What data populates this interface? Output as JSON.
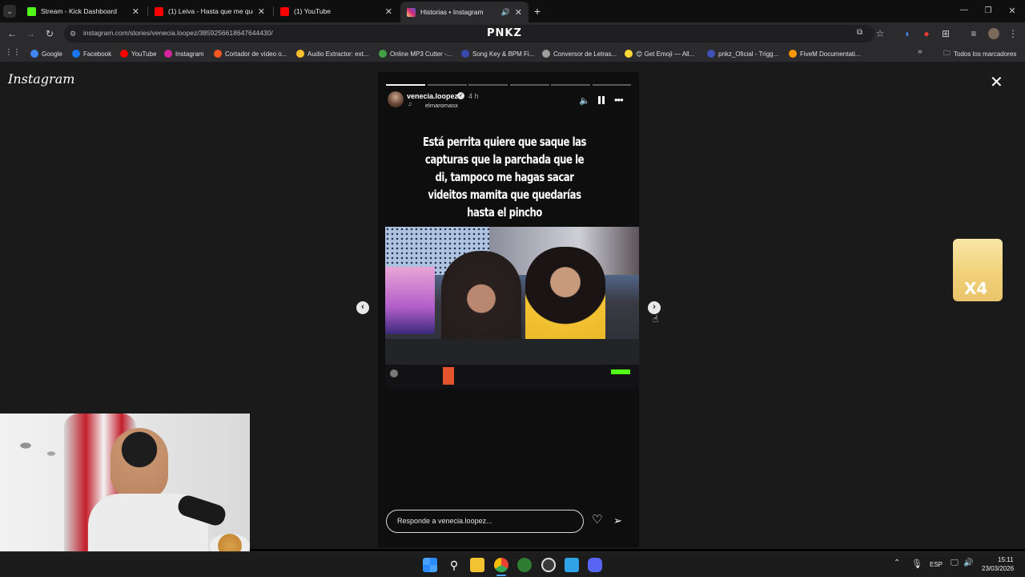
{
  "browser": {
    "tabs": [
      {
        "title": "Stream - Kick Dashboard",
        "favicon": "kick-icon",
        "color": "#53fc18"
      },
      {
        "title": "(1) Leiva - Hasta que me quede",
        "favicon": "youtube-icon",
        "color": "#ff0000"
      },
      {
        "title": "(1) YouTube",
        "favicon": "youtube-icon",
        "color": "#ff0000"
      },
      {
        "title": "Historias • Instagram",
        "favicon": "instagram-icon",
        "color": "#d6249f"
      }
    ],
    "url": "instagram.com/stories/venecia.loopez/3859256618647644430/",
    "profile_label": "PNKZ",
    "bookmarks": [
      {
        "label": "Google",
        "color": "#4285f4"
      },
      {
        "label": "Facebook",
        "color": "#1877f2"
      },
      {
        "label": "YouTube",
        "color": "#ff0000"
      },
      {
        "label": "Instagram",
        "color": "#d6249f"
      },
      {
        "label": "Cortador de vídeo o...",
        "color": "#ff5722"
      },
      {
        "label": "Audio Extractor: ext...",
        "color": "#fbc02d"
      },
      {
        "label": "Online MP3 Cutter -...",
        "color": "#43a047"
      },
      {
        "label": "Song Key & BPM Fi...",
        "color": "#3949ab"
      },
      {
        "label": "Conversor de Letras...",
        "color": "#9e9e9e"
      },
      {
        "label": "😊 Get Emoji — All...",
        "color": "#fdd835"
      },
      {
        "label": "pnkz_Oficial - Trigg...",
        "color": "#3f51b5"
      },
      {
        "label": "FiveM Documentati...",
        "color": "#ff9800"
      }
    ],
    "all_bookmarks_label": "Todos los marcadores"
  },
  "instagram": {
    "logo_text": "Instagram",
    "story": {
      "username": "venecia.loopez",
      "verified": true,
      "time_ago": "4 h",
      "audio_label": "elmaromasx",
      "caption": "Está perrita quiere que saque las capturas que la parchada que le di, tampoco me hagas sacar videitos mamita que quedarías hasta el pincho",
      "reply_placeholder": "Responde a venecia.loopez...",
      "segments_total": 6,
      "segments_done": 1
    }
  },
  "overlay": {
    "sticker_label": "X4"
  },
  "taskbar": {
    "language": "ESP",
    "time": "15:11",
    "date": "23/03/2026"
  }
}
